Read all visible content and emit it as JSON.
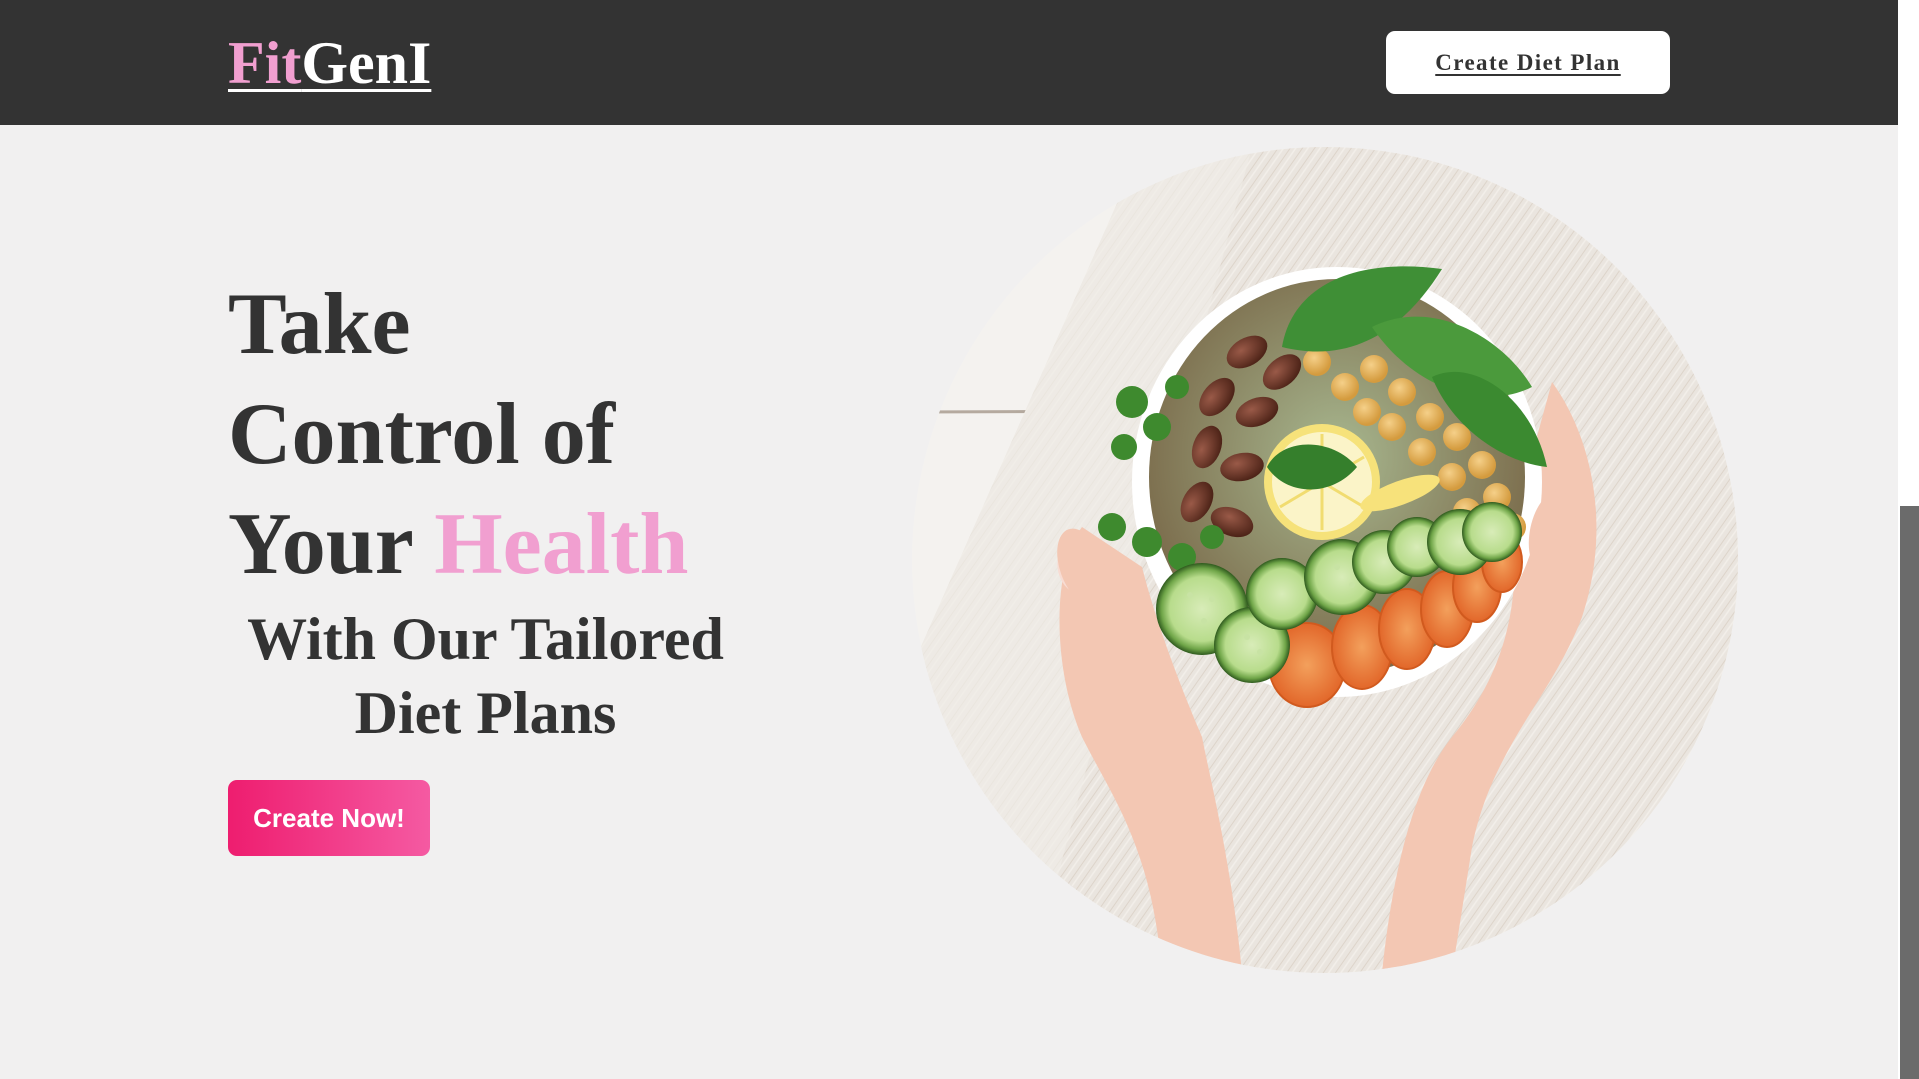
{
  "navbar": {
    "logo_part1": "Fit",
    "logo_part2": "GenI",
    "cta_label": "Create Diet Plan"
  },
  "hero": {
    "headline": {
      "line1": "Take",
      "line2": "Control of",
      "line3_prefix": "Your ",
      "line3_accent": "Health"
    },
    "subheadline": "With Our Tailored Diet Plans",
    "cta_label": "Create Now!",
    "image_subject": "hands-holding-salad-bowl"
  },
  "colors": {
    "navbar_bg": "#333333",
    "accent_pink": "#f19fd0",
    "cta_gradient_start": "#ee1d6f",
    "cta_gradient_end": "#f55aa2",
    "page_bg": "#f1f0f0",
    "text_dark": "#333333"
  }
}
